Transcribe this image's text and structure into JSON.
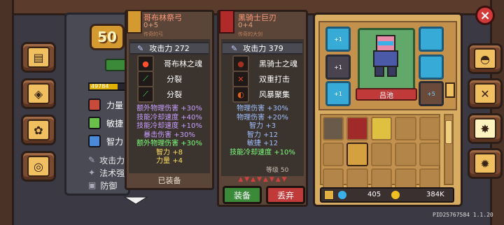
{
  "top_bar": {
    "close_label": "×"
  },
  "stats": {
    "level": "50",
    "xp_text": "49784",
    "rows": [
      {
        "label": "力量",
        "color": "#c84a3a"
      },
      {
        "label": "敏捷",
        "color": "#6ac04a"
      },
      {
        "label": "智力",
        "color": "#4a8ad8"
      }
    ],
    "sub_rows": [
      {
        "label": "攻击力"
      },
      {
        "label": "法术强"
      },
      {
        "label": "防御"
      }
    ]
  },
  "equipped": {
    "name": "哥布林祭弓",
    "plus": "0+5",
    "grade": "传奇的弓",
    "attack": "攻击力 272",
    "skills": [
      "哥布林之魂",
      "分裂",
      "分裂"
    ],
    "bonuses": [
      {
        "text": "额外物理伤害 +30%",
        "tone": "purple"
      },
      {
        "text": "技能冷却速度 +40%",
        "tone": "purple"
      },
      {
        "text": "技能冷却速度 +10%",
        "tone": "purple"
      },
      {
        "text": "暴击伤害 +30%",
        "tone": "purple"
      },
      {
        "text": "额外物理伤害 +30%",
        "tone": "green"
      },
      {
        "text": "智力 +8",
        "tone": "yellow"
      },
      {
        "text": "力量 +4",
        "tone": "yellow"
      }
    ],
    "status_label": "已装备"
  },
  "compare": {
    "name": "黑骑士巨刃",
    "plus": "0+4",
    "grade": "传奇的大剑",
    "attack": "攻击力 379",
    "skills": [
      "黑骑士之魂",
      "双重打击",
      "风暴聚集"
    ],
    "bonuses": [
      {
        "text": "物理伤害 +30%",
        "tone": "teal"
      },
      {
        "text": "物理伤害 +20%",
        "tone": "teal"
      },
      {
        "text": "智力 +3",
        "tone": "teal"
      },
      {
        "text": "智力 +12",
        "tone": "teal"
      },
      {
        "text": "敏捷 +12",
        "tone": "teal"
      },
      {
        "text": "技能冷却速度 +10%",
        "tone": "green"
      }
    ],
    "level_text": "等级 50",
    "equip_label": "装备",
    "discard_label": "丢弃"
  },
  "character": {
    "name": "吕池",
    "slots_left": [
      "+1",
      "+1",
      "+1"
    ],
    "weapon_plus": "+5"
  },
  "currency": {
    "gems": "405",
    "gold": "384K"
  },
  "pid": "PID25767584 1.1.20"
}
